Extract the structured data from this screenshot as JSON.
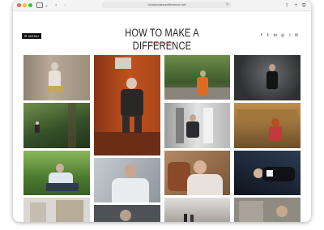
{
  "browser": {
    "url": "howtomakeadifference.net",
    "reload_icon": "reload-icon",
    "share_icon": "share-icon",
    "add_tab_icon": "plus-icon",
    "tabs_icon": "tabs-icon"
  },
  "header": {
    "menu_label": "☰ MENU",
    "title": "HOW TO MAKE A DIFFERENCE",
    "tagline": "FRAN MONKS"
  },
  "social": [
    {
      "name": "facebook-icon",
      "glyph": "f"
    },
    {
      "name": "twitter-icon",
      "glyph": "t"
    },
    {
      "name": "linkedin-icon",
      "glyph": "in"
    },
    {
      "name": "instagram-icon",
      "glyph": "◎"
    },
    {
      "name": "rss-icon",
      "glyph": "⌇"
    },
    {
      "name": "email-icon",
      "glyph": "✉"
    }
  ],
  "gallery": {
    "column_count": 4,
    "photo_count": 17
  }
}
